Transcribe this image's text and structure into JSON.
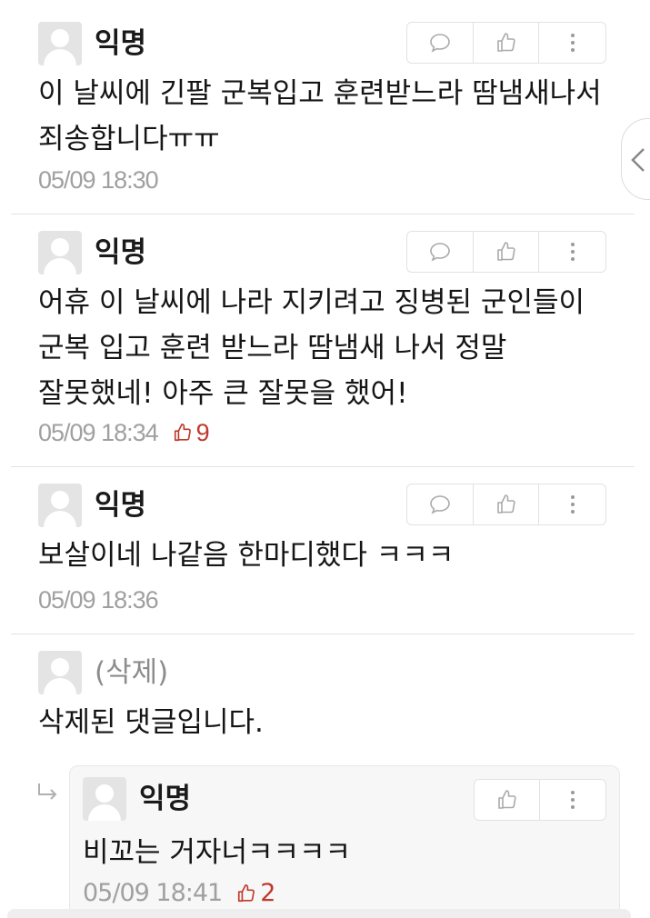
{
  "comments": [
    {
      "author": "익명",
      "text_lines": [
        "이 날씨에 긴팔 군복입고 훈련받느라 땀냄새나서",
        "죄송합니다ㅠㅠ"
      ],
      "timestamp": "05/09 18:30",
      "votes": ""
    },
    {
      "author": "익명",
      "text_lines": [
        "어휴 이 날씨에 나라 지키려고 징병된 군인들이",
        "군복 입고 훈련 받느라 땀냄새 나서 정말",
        "잘못했네! 아주 큰 잘못을 했어!"
      ],
      "timestamp": "05/09 18:34",
      "votes": "9"
    },
    {
      "author": "익명",
      "text_lines": [
        "보살이네 나같음 한마디했다 ㅋㅋㅋ"
      ],
      "timestamp": "05/09 18:36",
      "votes": ""
    },
    {
      "author": "(삭제)",
      "text_lines": [
        "삭제된 댓글입니다."
      ],
      "timestamp": "",
      "votes": ""
    }
  ],
  "reply": {
    "author": "익명",
    "text": "비꼬는 거자너ㅋㅋㅋㅋ",
    "timestamp": "05/09 18:41",
    "votes": "2"
  },
  "icons": {
    "reply": "speech-bubble-icon",
    "like": "thumbs-up-icon",
    "more": "vertical-dots-icon",
    "side_tab": "chevron-left-icon",
    "reply_arrow": "reply-arrow-icon"
  },
  "colors": {
    "vote": "#c0392b",
    "meta": "#a0a0a0",
    "deleted": "#8c8c8c"
  }
}
